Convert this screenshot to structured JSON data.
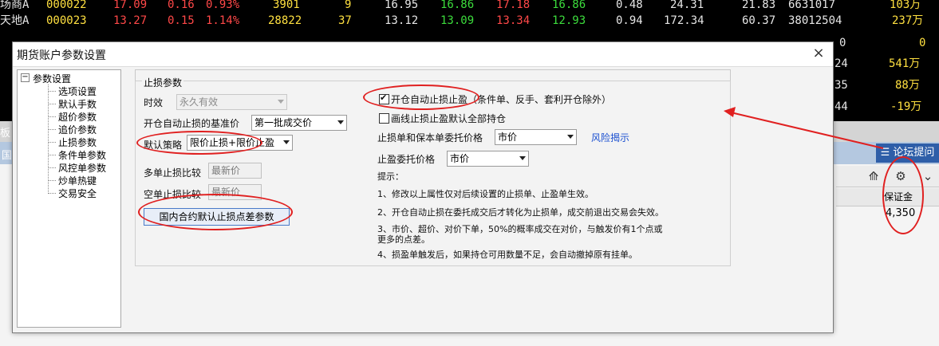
{
  "background": {
    "rows": [
      [
        "场商A",
        "000022",
        "17.09",
        "0.16",
        "0.93%",
        "3901",
        "9",
        "16.95",
        "16.86",
        "17.18",
        "16.86",
        "0.48",
        "24.31",
        "21.83",
        "6631017",
        "103万"
      ],
      [
        "天地A",
        "000023",
        "13.27",
        "0.15",
        "1.14%",
        "28822",
        "37",
        "13.12",
        "13.09",
        "13.34",
        "12.93",
        "0.94",
        "172.34",
        "60.37",
        "38012504",
        "237万"
      ],
      [
        "",
        "",
        "",
        "",
        "",
        "",
        "",
        "",
        "",
        "",
        "",
        "",
        "",
        "",
        "0",
        "0"
      ],
      [
        "",
        "",
        "",
        "",
        "",
        "",
        "",
        "",
        "",
        "",
        "",
        "",
        "",
        "",
        "24",
        "541万"
      ],
      [
        "",
        "",
        "",
        "",
        "",
        "",
        "",
        "",
        "",
        "",
        "",
        "",
        "",
        "",
        "35",
        "88万"
      ],
      [
        "",
        "",
        "",
        "",
        "",
        "",
        "",
        "",
        "",
        "",
        "",
        "",
        "",
        "",
        "44",
        "-19万"
      ]
    ],
    "forum_button": "论坛提问",
    "column_header": "保证金",
    "column_value": "4,350",
    "left_frags": [
      "板",
      "国"
    ]
  },
  "dialog": {
    "title": "期货账户参数设置",
    "close": "×",
    "tree": {
      "root": "参数设置",
      "expander": "−",
      "items": [
        "选项设置",
        "默认手数",
        "超价参数",
        "追价参数",
        "止损参数",
        "条件单参数",
        "风控单参数",
        "炒单热键",
        "交易安全"
      ]
    },
    "group_title": "止损参数",
    "left": {
      "validity_label": "时效",
      "validity_value": "永久有效",
      "base_price_label": "开仓自动止损的基准价",
      "base_price_value": "第一批成交价",
      "strategy_label": "默认策略",
      "strategy_value": "限价止损+限价止盈",
      "multi_compare_label": "多单止损比较",
      "multi_compare_value": "最新价",
      "short_compare_label": "空单止损比较",
      "short_compare_value": "最新价",
      "domestic_button": "国内合约默认止损点差参数"
    },
    "right": {
      "auto_stop_label": "开仓自动止损止盈（条件单、反手、套利开仓除外）",
      "line_stop_label": "画线止损止盈默认全部持仓",
      "order_price_label": "止损单和保本单委托价格",
      "order_price_value": "市价",
      "risk_link": "风险揭示",
      "profit_price_label": "止盈委托价格",
      "profit_price_value": "市价",
      "tips_title": "提示：",
      "tips": [
        "1、修改以上属性仅对后续设置的止损单、止盈单生效。",
        "2、开仓自动止损在委托成交后才转化为止损单，成交前退出交易会失效。",
        "3、市价、超价、对价下单，50%的概率成交在对价，与触发价有1个点或",
        "更多的点差。",
        "4、损盈单触发后，如果持仓可用数量不足，会自动撤掉原有挂单。"
      ]
    }
  },
  "colors": {
    "annotation": "#e02020",
    "link": "#1a4fd0",
    "forum_button": "#2e5ea8"
  }
}
